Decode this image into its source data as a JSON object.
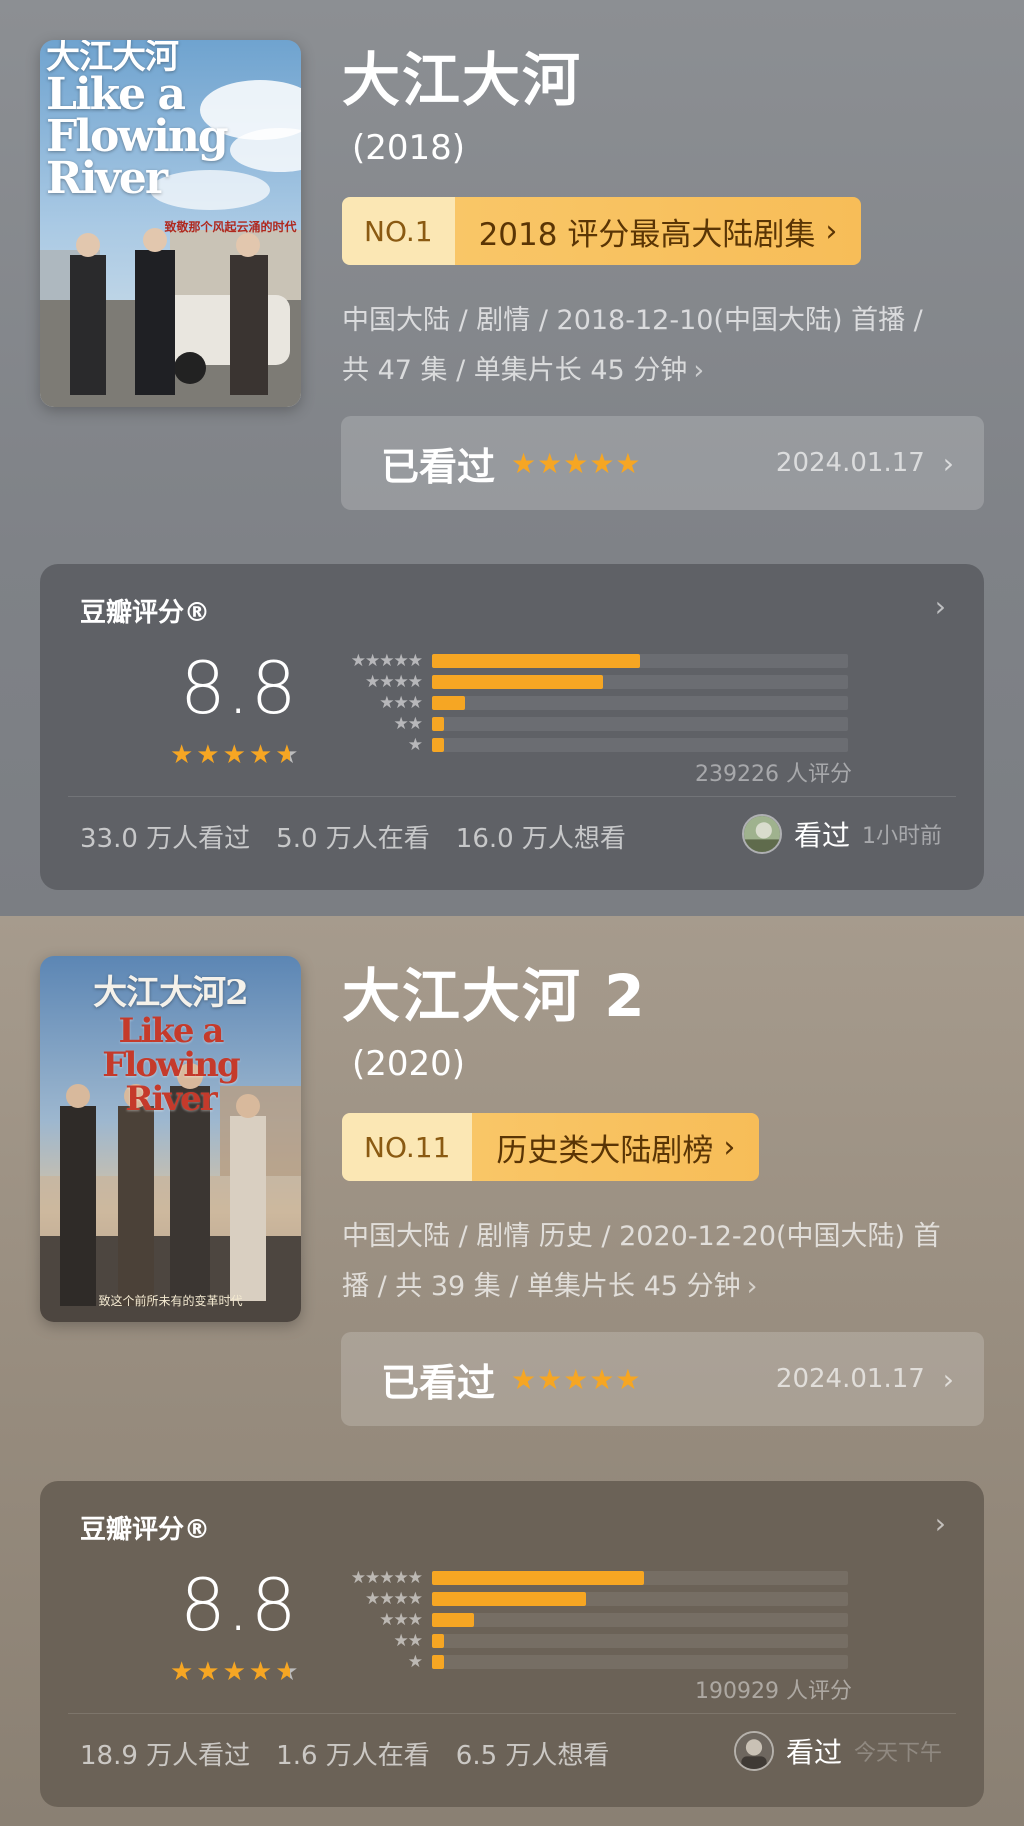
{
  "items": [
    {
      "poster": {
        "title_cn": "大江大河",
        "title_en": "Like a Flowing River",
        "tagline": "致敬那个风起云涌的时代"
      },
      "title": "大江大河",
      "year": "(2018)",
      "rank": {
        "no": "NO.1",
        "label": "2018 评分最高大陆剧集"
      },
      "meta_line1": "中国大陆 / 剧情 / 2018-12-10(中国大陆) 首播 /",
      "meta_line2": "共 47 集 / 单集片长 45 分钟",
      "watched": {
        "label": "已看过",
        "stars": "★★★★★",
        "date": "2024.01.17"
      },
      "rating": {
        "brand": "豆瓣评分®",
        "score": "8.8",
        "score_value": 8.8,
        "distribution": [
          {
            "stars": "★★★★★",
            "fraction": 0.5
          },
          {
            "stars": "★★★★",
            "fraction": 0.41
          },
          {
            "stars": "★★★",
            "fraction": 0.08
          },
          {
            "stars": "★★",
            "fraction": 0.02
          },
          {
            "stars": "★",
            "fraction": 0.02
          }
        ],
        "count": "239226 人评分",
        "watched": "33.0 万人看过",
        "watching": "5.0 万人在看",
        "want": "16.0 万人想看",
        "friend_action": "看过",
        "friend_time": "1小时前"
      }
    },
    {
      "poster": {
        "title_cn": "大江大河2",
        "title_en": "Like a Flowing River",
        "tagline": "致这个前所未有的变革时代"
      },
      "title": "大江大河 2",
      "year": "(2020)",
      "rank": {
        "no": "NO.11",
        "label": "历史类大陆剧榜"
      },
      "meta_line1": "中国大陆 / 剧情 历史 / 2020-12-20(中国大陆) 首",
      "meta_line2": "播 / 共 39 集 / 单集片长 45 分钟",
      "watched": {
        "label": "已看过",
        "stars": "★★★★★",
        "date": "2024.01.17"
      },
      "rating": {
        "brand": "豆瓣评分®",
        "score": "8.8",
        "score_value": 8.8,
        "distribution": [
          {
            "stars": "★★★★★",
            "fraction": 0.51
          },
          {
            "stars": "★★★★",
            "fraction": 0.37
          },
          {
            "stars": "★★★",
            "fraction": 0.1
          },
          {
            "stars": "★★",
            "fraction": 0.02
          },
          {
            "stars": "★",
            "fraction": 0.02
          }
        ],
        "count": "190929 人评分",
        "watched": "18.9 万人看过",
        "watching": "1.6 万人在看",
        "want": "6.5 万人想看",
        "friend_action": "看过",
        "friend_time": "今天下午"
      }
    }
  ],
  "colors": {
    "accent": "#f6a623",
    "rank_bg": "#f9c667"
  }
}
